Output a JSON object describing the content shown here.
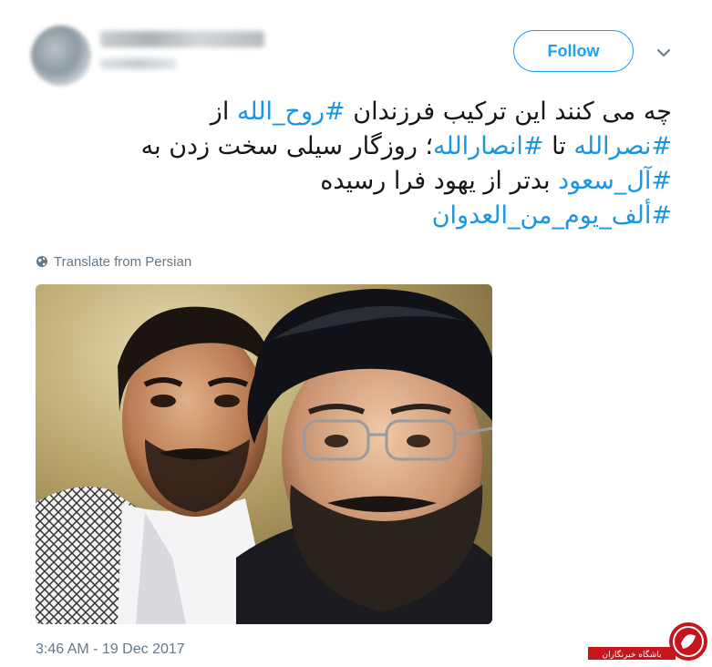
{
  "header": {
    "follow_label": "Follow"
  },
  "tweet": {
    "lines": [
      [
        {
          "text": "چه می کنند این ترکیب فرزندان ",
          "tag": false
        },
        {
          "text": "#روح_الله",
          "tag": true
        },
        {
          "text": " از",
          "tag": false
        }
      ],
      [
        {
          "text": "#نصرالله",
          "tag": true
        },
        {
          "text": " تا ",
          "tag": false
        },
        {
          "text": "#انصارالله",
          "tag": true
        },
        {
          "text": "؛ روزگار سیلی سخت زدن به",
          "tag": false
        }
      ],
      [
        {
          "text": "#آل_سعود",
          "tag": true
        },
        {
          "text": " بدتر از یهود فرا رسیده",
          "tag": false
        }
      ],
      [
        {
          "text": "#ألف_يوم_من_العدوان",
          "tag": true
        }
      ]
    ],
    "translate_label": "Translate from Persian",
    "timestamp": "3:46 AM - 19 Dec 2017"
  },
  "watermark": {
    "text": "باشگاه خبرنگاران"
  },
  "colors": {
    "accent": "#1da1f2",
    "hashtag": "#1b95e0",
    "secondary_text": "#657786",
    "watermark_red": "#c4161c"
  },
  "icons": {
    "caret": "chevron-down-icon",
    "translate": "globe-icon"
  }
}
